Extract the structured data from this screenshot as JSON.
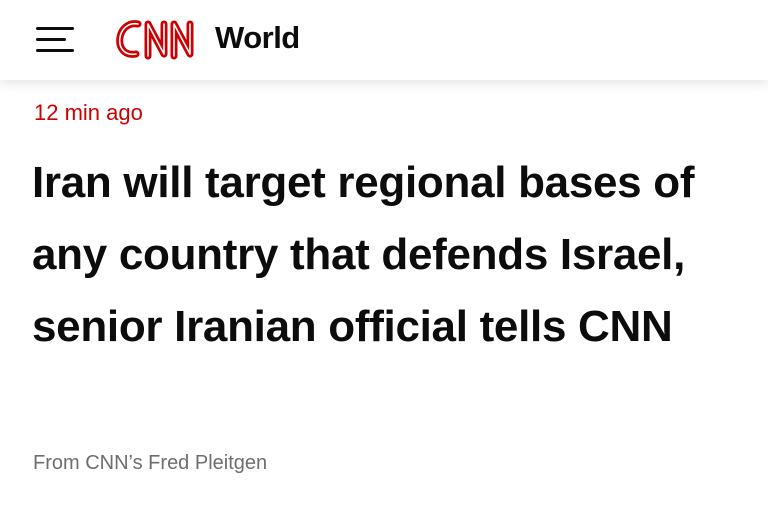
{
  "header": {
    "menu_icon": "hamburger-menu-icon",
    "logo_text": "CNN",
    "section": "World",
    "brand_color": "#cc0000"
  },
  "article": {
    "timestamp": "12 min ago",
    "headline": "Iran will target regional bases of any country that defends Israel, senior Iranian official tells CNN",
    "byline": "From CNN’s Fred Pleitgen",
    "timestamp_color": "#cc0000",
    "byline_color": "#6e6e6e"
  }
}
